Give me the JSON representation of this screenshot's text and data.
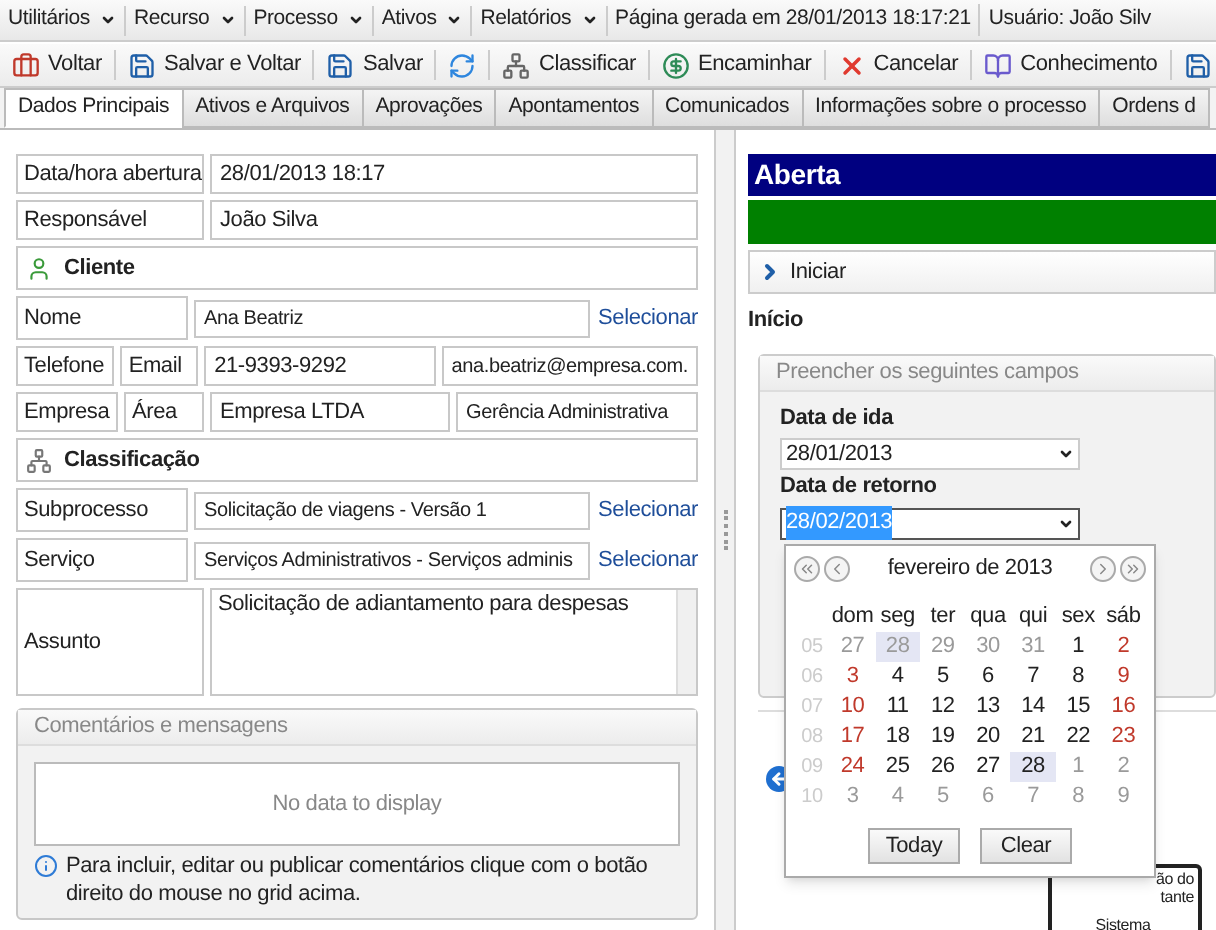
{
  "menu": {
    "items": [
      {
        "label": "Utilitários"
      },
      {
        "label": "Recurso"
      },
      {
        "label": "Processo"
      },
      {
        "label": "Ativos"
      },
      {
        "label": "Relatórios"
      }
    ],
    "page_info": "Página gerada em 28/01/2013 18:17:21",
    "user": "Usuário: João Silv"
  },
  "toolbar": [
    {
      "kind": "back",
      "label": "Voltar"
    },
    {
      "kind": "save-back",
      "label": "Salvar e Voltar"
    },
    {
      "kind": "save",
      "label": "Salvar"
    },
    {
      "kind": "refresh"
    },
    {
      "kind": "classify",
      "label": "Classificar"
    },
    {
      "kind": "forward",
      "label": "Encaminhar"
    },
    {
      "kind": "cancel",
      "label": "Cancelar"
    },
    {
      "kind": "knowledge",
      "label": "Conhecimento"
    },
    {
      "kind": "save"
    }
  ],
  "tabs": [
    {
      "label": "Dados Principais",
      "selected": true
    },
    {
      "label": "Ativos e Arquivos",
      "selected": false
    },
    {
      "label": "Aprovações",
      "selected": false
    },
    {
      "label": "Apontamentos",
      "selected": false
    },
    {
      "label": "Comunicados",
      "selected": false
    },
    {
      "label": "Informações sobre o processo",
      "selected": false
    },
    {
      "label": "Ordens d",
      "selected": false
    }
  ],
  "form": [
    {
      "kind": "field",
      "label": "Data/hora abertura",
      "value": "28/01/2013 18:17"
    },
    {
      "kind": "field",
      "label": "Responsável",
      "value": "João Silva"
    },
    {
      "kind": "section",
      "label": "Cliente"
    },
    {
      "kind": "lookup",
      "label": "Nome",
      "value": "Ana Beatriz",
      "link": "Selecionar"
    },
    {
      "kind": "pair",
      "label": "Telefone",
      "label_2": "Email",
      "value": "21-9393-9292",
      "value_2": "ana.beatriz@empresa.com."
    },
    {
      "kind": "pair",
      "label": "Empresa",
      "label_2": "Área",
      "value": "Empresa LTDA",
      "value_2": "Gerência Administrativa"
    },
    {
      "kind": "section",
      "label": "Classificação"
    },
    {
      "kind": "lookup",
      "label": "Subprocesso",
      "value": "Solicitação de viagens - Versão 1",
      "link": "Selecionar"
    },
    {
      "kind": "lookup",
      "label": "Serviço",
      "value": "Serviços Administrativos - Serviços adminis",
      "link": "Selecionar"
    },
    {
      "kind": "textarea",
      "label": "Assunto",
      "value": "Solicitação de adiantamento para despesas"
    }
  ],
  "comments": {
    "title": "Comentários e mensagens",
    "empty": "No data to display",
    "hint": "Para incluir, editar ou publicar comentários clique com o botão direito do mouse no grid acima."
  },
  "status": {
    "title": "Aberta",
    "progress": {
      "level": 1
    },
    "step": "Iniciar",
    "heading": "Início"
  },
  "fill_panel": {
    "title": "Preencher os seguintes campos",
    "fields": [
      {
        "label": "Data de ida",
        "value": "28/01/2013",
        "focused": false
      },
      {
        "label": "Data de retorno",
        "value": "28/02/2013",
        "focused": true
      }
    ]
  },
  "calendar": {
    "title": "fevereiro de 2013",
    "weekdays": [
      "dom",
      "seg",
      "ter",
      "qua",
      "qui",
      "sex",
      "sáb"
    ],
    "weeks": [
      {
        "number": "05",
        "days": [
          {
            "label": "27",
            "kind": "other",
            "selected": false
          },
          {
            "label": "28",
            "kind": "other",
            "selected": true
          },
          {
            "label": "29",
            "kind": "other",
            "selected": false
          },
          {
            "label": "30",
            "kind": "other",
            "selected": false
          },
          {
            "label": "31",
            "kind": "other",
            "selected": false
          },
          {
            "label": "1",
            "kind": "weekday",
            "selected": false
          },
          {
            "label": "2",
            "kind": "weekend",
            "selected": false
          }
        ]
      },
      {
        "number": "06",
        "days": [
          {
            "label": "3",
            "kind": "weekend",
            "selected": false
          },
          {
            "label": "4",
            "kind": "weekday",
            "selected": false
          },
          {
            "label": "5",
            "kind": "weekday",
            "selected": false
          },
          {
            "label": "6",
            "kind": "weekday",
            "selected": false
          },
          {
            "label": "7",
            "kind": "weekday",
            "selected": false
          },
          {
            "label": "8",
            "kind": "weekday",
            "selected": false
          },
          {
            "label": "9",
            "kind": "weekend",
            "selected": false
          }
        ]
      },
      {
        "number": "07",
        "days": [
          {
            "label": "10",
            "kind": "weekend",
            "selected": false
          },
          {
            "label": "11",
            "kind": "weekday",
            "selected": false
          },
          {
            "label": "12",
            "kind": "weekday",
            "selected": false
          },
          {
            "label": "13",
            "kind": "weekday",
            "selected": false
          },
          {
            "label": "14",
            "kind": "weekday",
            "selected": false
          },
          {
            "label": "15",
            "kind": "weekday",
            "selected": false
          },
          {
            "label": "16",
            "kind": "weekend",
            "selected": false
          }
        ]
      },
      {
        "number": "08",
        "days": [
          {
            "label": "17",
            "kind": "weekend",
            "selected": false
          },
          {
            "label": "18",
            "kind": "weekday",
            "selected": false
          },
          {
            "label": "19",
            "kind": "weekday",
            "selected": false
          },
          {
            "label": "20",
            "kind": "weekday",
            "selected": false
          },
          {
            "label": "21",
            "kind": "weekday",
            "selected": false
          },
          {
            "label": "22",
            "kind": "weekday",
            "selected": false
          },
          {
            "label": "23",
            "kind": "weekend",
            "selected": false
          }
        ]
      },
      {
        "number": "09",
        "days": [
          {
            "label": "24",
            "kind": "weekend",
            "selected": false
          },
          {
            "label": "25",
            "kind": "weekday",
            "selected": false
          },
          {
            "label": "26",
            "kind": "weekday",
            "selected": false
          },
          {
            "label": "27",
            "kind": "weekday",
            "selected": false
          },
          {
            "label": "28",
            "kind": "weekday",
            "selected": true
          },
          {
            "label": "1",
            "kind": "other",
            "selected": false
          },
          {
            "label": "2",
            "kind": "other",
            "selected": false
          }
        ]
      },
      {
        "number": "10",
        "days": [
          {
            "label": "3",
            "kind": "other",
            "selected": false
          },
          {
            "label": "4",
            "kind": "other",
            "selected": false
          },
          {
            "label": "5",
            "kind": "other",
            "selected": false
          },
          {
            "label": "6",
            "kind": "other",
            "selected": false
          },
          {
            "label": "7",
            "kind": "other",
            "selected": false
          },
          {
            "label": "8",
            "kind": "other",
            "selected": false
          },
          {
            "label": "9",
            "kind": "other",
            "selected": false
          }
        ]
      }
    ],
    "buttons": [
      "Today",
      "Clear"
    ]
  },
  "diagram": {
    "node_lines": [
      "ão do",
      "tante"
    ],
    "lane": "Sistema"
  }
}
